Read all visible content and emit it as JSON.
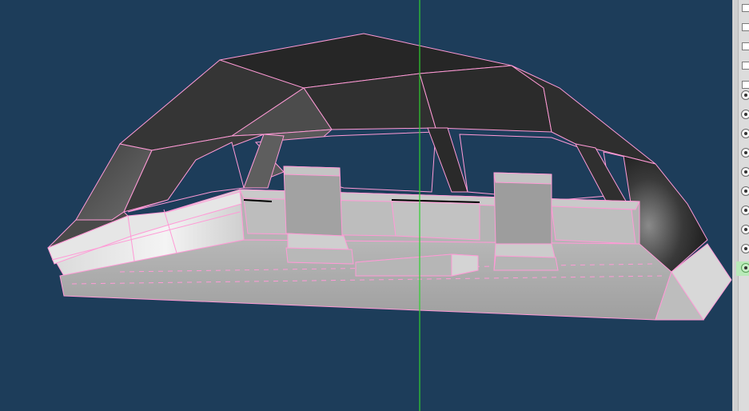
{
  "viewport": {
    "background": "#1d3d5a",
    "axis_color": "#2fd02f",
    "wire_color": "#ff9ad6",
    "roof_color": "#2a2a2a",
    "body_color": "#a9a9a9"
  },
  "right_panel": {
    "checkboxes": [
      {
        "name": "option-1",
        "checked": false
      },
      {
        "name": "option-2",
        "checked": false
      },
      {
        "name": "option-3",
        "checked": false
      },
      {
        "name": "option-4",
        "checked": false
      },
      {
        "name": "option-5",
        "checked": false
      }
    ],
    "radios": [
      {
        "name": "choice-1",
        "selected": true
      },
      {
        "name": "choice-2",
        "selected": true
      },
      {
        "name": "choice-3",
        "selected": true
      },
      {
        "name": "choice-4",
        "selected": true
      },
      {
        "name": "choice-5",
        "selected": true
      },
      {
        "name": "choice-6",
        "selected": true
      },
      {
        "name": "choice-7",
        "selected": true
      },
      {
        "name": "choice-8",
        "selected": true
      },
      {
        "name": "choice-9",
        "selected": true
      },
      {
        "name": "choice-10",
        "selected": true
      }
    ],
    "active_radio_index": 9
  }
}
